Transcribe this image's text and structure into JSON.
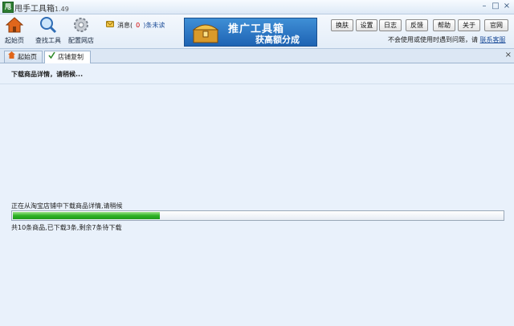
{
  "window": {
    "title": "甩手工具箱",
    "version": "1.49",
    "app_icon_letter": "甩"
  },
  "toolbar": {
    "home_label": "起始页",
    "find_label": "查找工具",
    "config_label": "配置网店",
    "message_label": "消息(",
    "message_count": "0",
    "unread_label": ")条未读",
    "banner_line1": "推广工具箱",
    "banner_line2": "获高额分成",
    "buttons": [
      "换肤",
      "设置",
      "日志",
      "反馈",
      "帮助",
      "关于",
      "官网"
    ],
    "notice_text": "不会使用或使用时遇到问题，请",
    "notice_link": "联系客服"
  },
  "tabs": [
    {
      "label": "起始页",
      "icon": "home-icon",
      "active": false
    },
    {
      "label": "店铺复制",
      "icon": "check-icon",
      "active": true
    }
  ],
  "content": {
    "heading": "下载商品详情，请稍候...",
    "status": "正在从淘宝店铺中下载商品详情,请稍候",
    "progress": 0.3,
    "summary": "共10条商品,已下载3条,剩余7条待下载"
  },
  "colors": {
    "progress": "#2eb326",
    "banner": "#1e63b3",
    "accent": "#1f4f9a"
  }
}
